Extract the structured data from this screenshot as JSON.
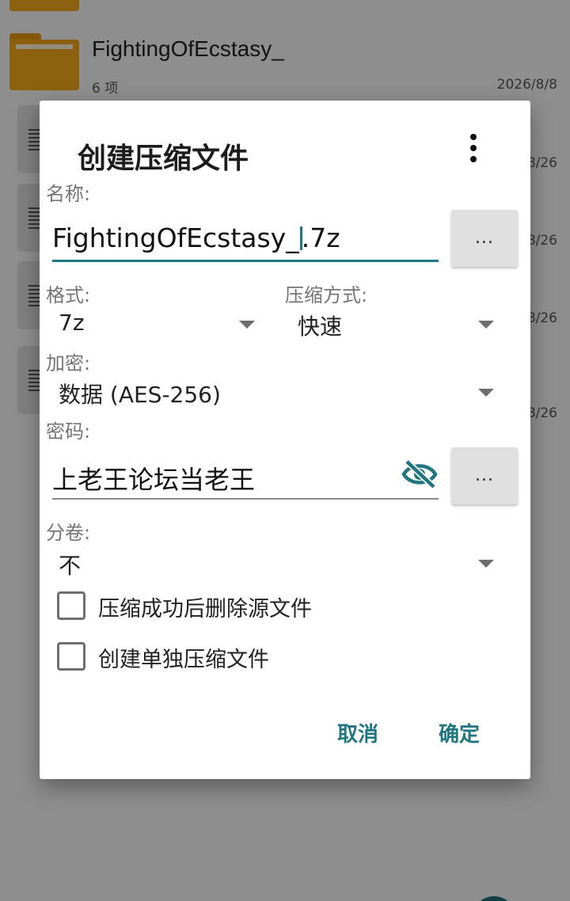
{
  "background": {
    "folder_name": "FightingOfEcstasy_",
    "folder_meta": "6 项",
    "folder_date": "2026/8/8",
    "row_dates": [
      "8/26",
      "8/26",
      "8/26",
      "8/26"
    ]
  },
  "dialog": {
    "title": "创建压缩文件",
    "name_label": "名称:",
    "name_value_before_caret": "FightingOfEcstasy_",
    "name_value_after_caret": ".7z",
    "browse_label": "...",
    "format_label": "格式:",
    "format_value": "7z",
    "compression_label": "压缩方式:",
    "compression_value": "快速",
    "encryption_label": "加密:",
    "encryption_value": "数据 (AES-256)",
    "password_label": "密码:",
    "password_value": "上老王论坛当老王",
    "password_browse_label": "...",
    "split_label": "分卷:",
    "split_value": "不",
    "checkbox_delete_source": {
      "label": "压缩成功后删除源文件",
      "checked": false
    },
    "checkbox_separate": {
      "label": "创建单独压缩文件",
      "checked": false
    },
    "cancel_label": "取消",
    "ok_label": "确定"
  },
  "colors": {
    "accent": "#1f7680",
    "folder": "#f3a51c",
    "scrim": "rgba(0,0,0,0.42)"
  }
}
